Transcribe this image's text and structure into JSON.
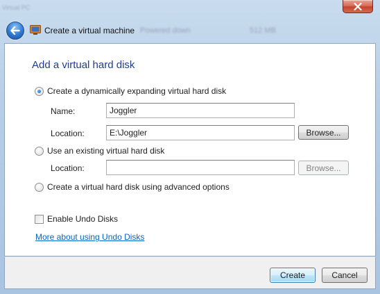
{
  "window": {
    "title": "Create a virtual machine",
    "background_text": [
      "Powered down",
      "512 MB"
    ],
    "background_small": "Virtual PC"
  },
  "page": {
    "heading": "Add a virtual hard disk"
  },
  "options": {
    "dynamic": {
      "label": "Create a dynamically expanding virtual hard disk",
      "selected": true,
      "name_label": "Name:",
      "name_value": "Joggler",
      "location_label": "Location:",
      "location_value": "E:\\Joggler",
      "browse_label": "Browse..."
    },
    "existing": {
      "label": "Use an existing virtual hard disk",
      "selected": false,
      "location_label": "Location:",
      "location_value": "",
      "browse_label": "Browse..."
    },
    "advanced": {
      "label": "Create a virtual hard disk using advanced options",
      "selected": false
    }
  },
  "undo": {
    "checkbox_label": "Enable Undo Disks",
    "checked": false,
    "link_text": "More about using Undo Disks"
  },
  "footer": {
    "create_label": "Create",
    "cancel_label": "Cancel"
  },
  "colors": {
    "heading": "#1e3d8f",
    "link": "#0066cc",
    "close_button": "#c4442c"
  }
}
